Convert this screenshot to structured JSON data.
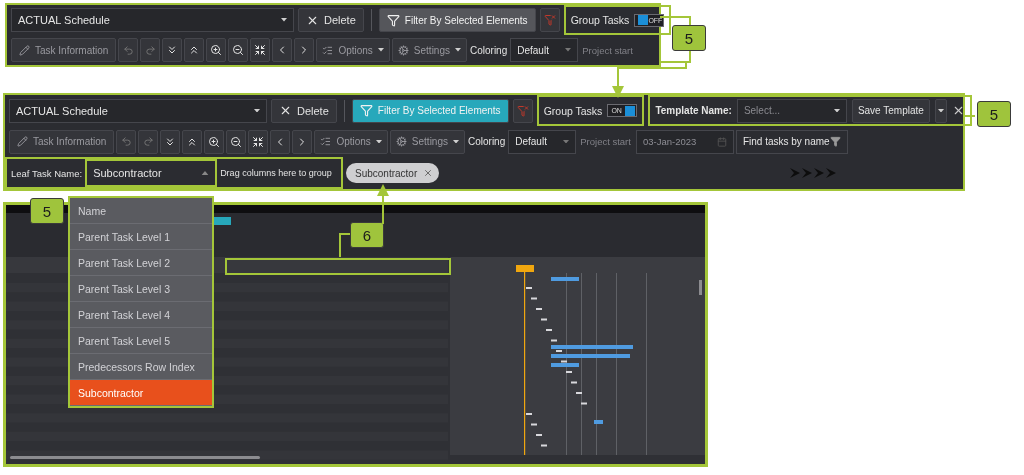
{
  "toolbar_collapsed": {
    "schedule": "ACTUAL Schedule",
    "delete": "Delete",
    "filter": {
      "label": "Filter By Selected Elements",
      "active": false
    },
    "group_tasks": {
      "label": "Group Tasks",
      "on": false,
      "state_text": "OFF"
    },
    "task_information": "Task Information",
    "options": "Options",
    "settings": "Settings",
    "coloring": {
      "label": "Coloring",
      "value": "Default"
    },
    "project_start": {
      "label": "Project start",
      "disabled": true
    }
  },
  "callouts": [
    {
      "label": "5"
    },
    {
      "label": "5"
    },
    {
      "label": "5"
    },
    {
      "label": "6"
    }
  ],
  "toolbar_expanded": {
    "schedule": "ACTUAL Schedule",
    "delete": "Delete",
    "filter": {
      "label": "Filter By Selected Elements",
      "active": true
    },
    "group_tasks": {
      "label": "Group Tasks",
      "on": true,
      "state_text": "ON"
    },
    "template": {
      "label": "Template Name:",
      "placeholder": "Select...",
      "save": "Save Template"
    },
    "task_information": "Task Information",
    "options": "Options",
    "settings": "Settings",
    "coloring": {
      "label": "Coloring",
      "value": "Default"
    },
    "project_start": {
      "label": "Project start",
      "disabled": true
    },
    "start_date": {
      "value": "03-Jan-2023",
      "disabled": true
    },
    "find": {
      "placeholder": "Find tasks by name"
    },
    "grouping": {
      "leaf_label": "Leaf Task Name:",
      "leaf_value": "Subcontractor",
      "expanded": true,
      "drop_hint": "Drag columns here to group",
      "chips": [
        {
          "label": "Subcontractor"
        }
      ]
    }
  },
  "leaf_dropdown": {
    "items": [
      {
        "label": "Name",
        "selected": false
      },
      {
        "label": "Parent Task Level 1",
        "selected": false
      },
      {
        "label": "Parent Task Level 2",
        "selected": false
      },
      {
        "label": "Parent Task Level 3",
        "selected": false
      },
      {
        "label": "Parent Task Level 4",
        "selected": false
      },
      {
        "label": "Parent Task Level 5",
        "selected": false
      },
      {
        "label": "Predecessors Row Index",
        "selected": false
      },
      {
        "label": "Subcontractor",
        "selected": true
      }
    ]
  }
}
